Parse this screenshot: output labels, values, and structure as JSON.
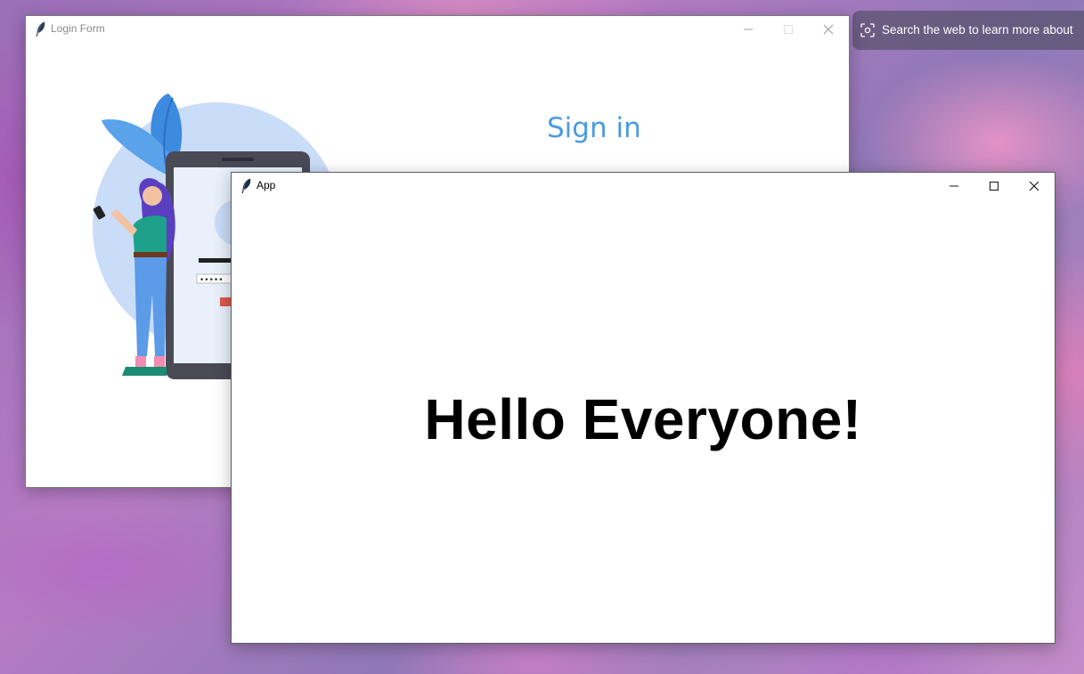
{
  "desktop": {
    "search_web_prompt": "Search the web to learn more about",
    "search_icon": "visual-search-icon"
  },
  "login_window": {
    "title": "Login Form",
    "app_icon": "feather-icon",
    "heading": "Sign in",
    "accent_color": "#4a9be0",
    "password_mask": "•••••",
    "controls": [
      "minimize-icon",
      "maximize-icon",
      "close-icon"
    ]
  },
  "app_window": {
    "title": "App",
    "app_icon": "feather-icon",
    "message": "Hello Everyone!",
    "controls": [
      "minimize-icon",
      "maximize-icon",
      "close-icon"
    ]
  }
}
